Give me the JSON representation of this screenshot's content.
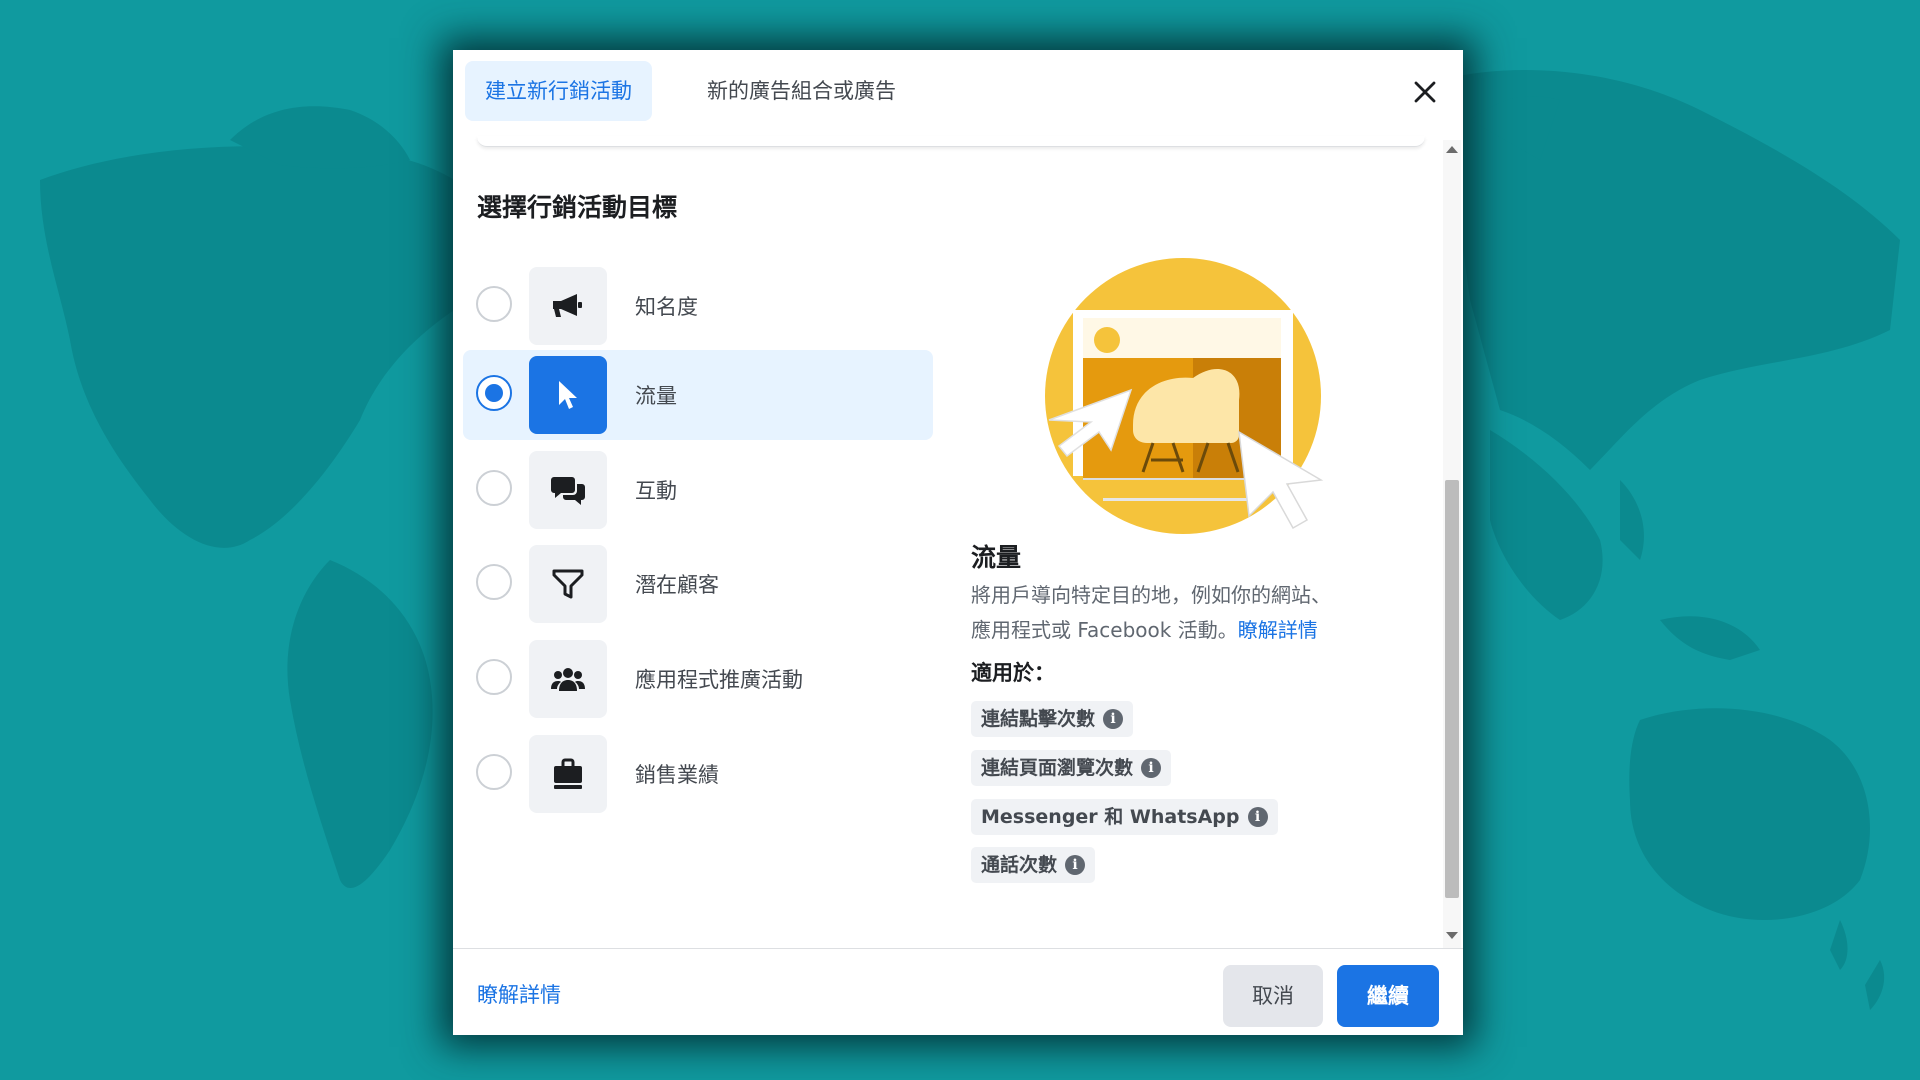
{
  "tabs": [
    {
      "label": "建立新行銷活動"
    },
    {
      "label": "新的廣告組合或廣告"
    }
  ],
  "section_title": "選擇行銷活動目標",
  "objectives": [
    {
      "label": "知名度",
      "icon": "megaphone-icon"
    },
    {
      "label": "流量",
      "icon": "cursor-icon"
    },
    {
      "label": "互動",
      "icon": "chat-bubbles-icon"
    },
    {
      "label": "潛在顧客",
      "icon": "funnel-icon"
    },
    {
      "label": "應用程式推廣活動",
      "icon": "people-icon"
    },
    {
      "label": "銷售業績",
      "icon": "shopping-bag-icon"
    }
  ],
  "selected_objective": "流量",
  "detail": {
    "title": "流量",
    "description_line1": "將用戶導向特定目的地，例如你的網站、",
    "description_line2": "應用程式或 Facebook 活動。",
    "learn_more": "瞭解詳情",
    "applies_label": "適用於：",
    "chips": [
      {
        "label": "連結點擊次數"
      },
      {
        "label": "連結頁面瀏覽次數"
      },
      {
        "label": "Messenger 和 WhatsApp"
      },
      {
        "label": "通話次數"
      }
    ],
    "info_glyph": "i"
  },
  "footer": {
    "learn_more": "瞭解詳情",
    "cancel": "取消",
    "continue": "繼續"
  },
  "colors": {
    "background": "#109a9f",
    "accent": "#1b74e4",
    "selected_bg": "#e7f3ff",
    "illustration_yellow": "#f5c33b"
  }
}
